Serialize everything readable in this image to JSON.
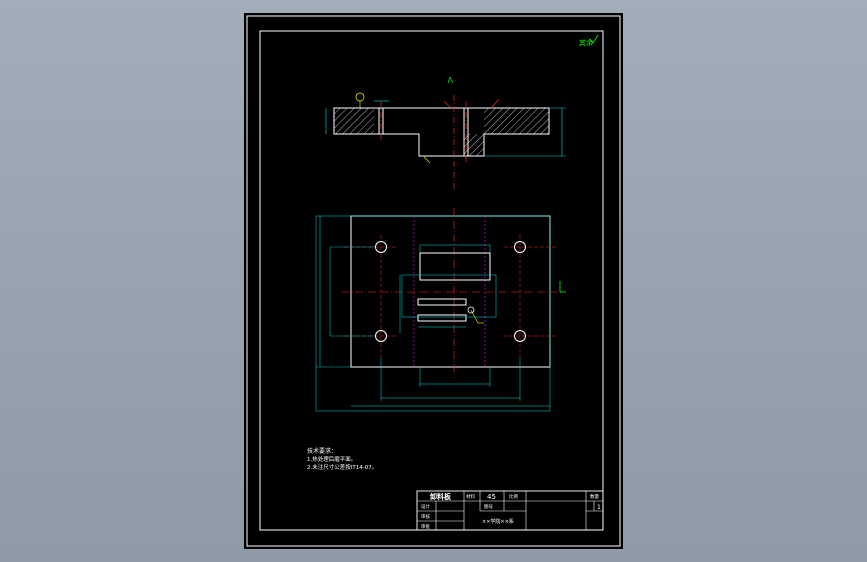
{
  "sheet": {
    "corner_mark": "其余",
    "notes": {
      "heading": "技术要求：",
      "line1": "1.热处理后磨平面。",
      "line2": "2.未注尺寸公差按IT14-07。"
    },
    "title_block": {
      "part_name": "卸料板",
      "material_label": "材料",
      "material_value": "45",
      "ratio_label": "比例",
      "quantity_label": "数量",
      "qty_value": "1",
      "design_label": "设计",
      "check_label": "审核",
      "approve_label": "审批",
      "drawing_no_label": "图号",
      "school_label": "××学院××系"
    }
  },
  "colors": {
    "frame": "#ffffff",
    "object": "#ffffff",
    "center": "#ff2020",
    "dimension": "#00e0e0",
    "hidden": "#ff00ff",
    "note": "#ffff00",
    "hatch": "#ffffff",
    "accent": "#00ff00"
  }
}
